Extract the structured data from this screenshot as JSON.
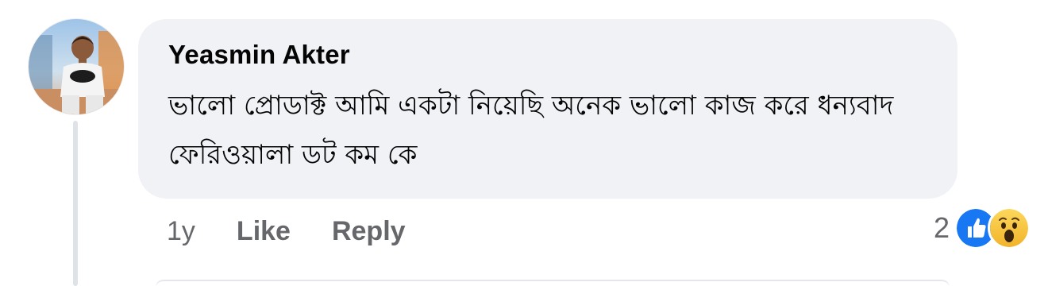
{
  "comment": {
    "author": "Yeasmin Akter",
    "text": "ভালো প্রোডাক্ট আমি একটা নিয়েছি অনেক ভালো কাজ করে ধন্যবাদ ফেরিওয়ালা ডট কম কে",
    "avatar_icon": "profile-photo-child-batman-shirt"
  },
  "actions": {
    "time": "1y",
    "like_label": "Like",
    "reply_label": "Reply"
  },
  "reactions": {
    "count": "2",
    "types": [
      "like",
      "wow"
    ],
    "like_color": "#1877f2",
    "wow_color": "#f7c33b"
  },
  "colors": {
    "bubble": "#f0f2f5",
    "secondary_text": "#65676b",
    "primary_text": "#050505"
  }
}
